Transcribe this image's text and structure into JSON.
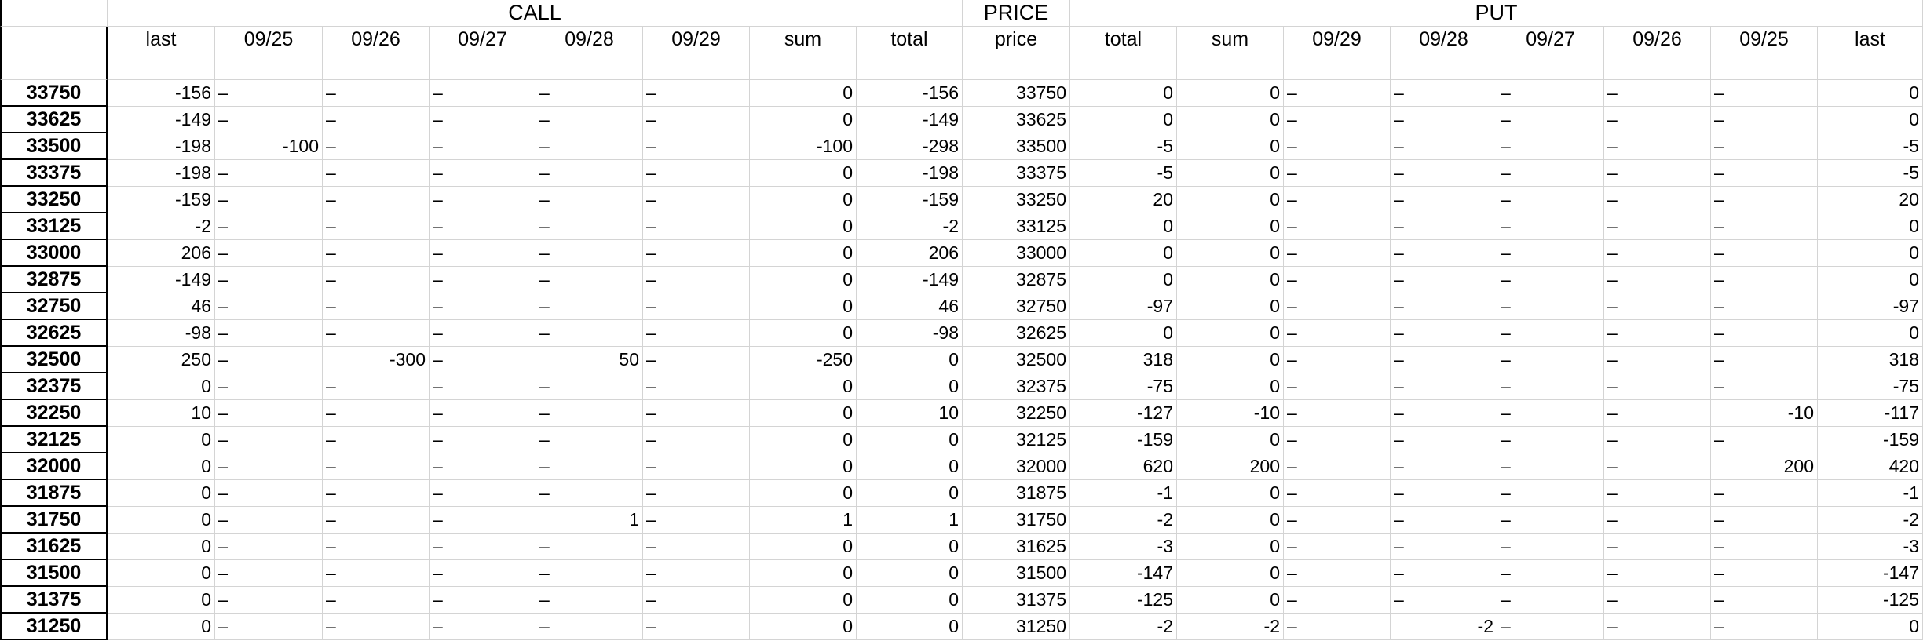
{
  "groups": [
    "CALL",
    "PRICE",
    "PUT"
  ],
  "columns": [
    "",
    "last",
    "09/25",
    "09/26",
    "09/27",
    "09/28",
    "09/29",
    "sum",
    "total",
    "price",
    "total",
    "sum",
    "09/29",
    "09/28",
    "09/27",
    "09/26",
    "09/25",
    "last"
  ],
  "rows": [
    [
      "33750",
      "-156",
      "–",
      "–",
      "–",
      "–",
      "–",
      "0",
      "-156",
      "33750",
      "0",
      "0",
      "–",
      "–",
      "–",
      "–",
      "–",
      "0"
    ],
    [
      "33625",
      "-149",
      "–",
      "–",
      "–",
      "–",
      "–",
      "0",
      "-149",
      "33625",
      "0",
      "0",
      "–",
      "–",
      "–",
      "–",
      "–",
      "0"
    ],
    [
      "33500",
      "-198",
      "-100",
      "–",
      "–",
      "–",
      "–",
      "-100",
      "-298",
      "33500",
      "-5",
      "0",
      "–",
      "–",
      "–",
      "–",
      "–",
      "-5"
    ],
    [
      "33375",
      "-198",
      "–",
      "–",
      "–",
      "–",
      "–",
      "0",
      "-198",
      "33375",
      "-5",
      "0",
      "–",
      "–",
      "–",
      "–",
      "–",
      "-5"
    ],
    [
      "33250",
      "-159",
      "–",
      "–",
      "–",
      "–",
      "–",
      "0",
      "-159",
      "33250",
      "20",
      "0",
      "–",
      "–",
      "–",
      "–",
      "–",
      "20"
    ],
    [
      "33125",
      "-2",
      "–",
      "–",
      "–",
      "–",
      "–",
      "0",
      "-2",
      "33125",
      "0",
      "0",
      "–",
      "–",
      "–",
      "–",
      "–",
      "0"
    ],
    [
      "33000",
      "206",
      "–",
      "–",
      "–",
      "–",
      "–",
      "0",
      "206",
      "33000",
      "0",
      "0",
      "–",
      "–",
      "–",
      "–",
      "–",
      "0"
    ],
    [
      "32875",
      "-149",
      "–",
      "–",
      "–",
      "–",
      "–",
      "0",
      "-149",
      "32875",
      "0",
      "0",
      "–",
      "–",
      "–",
      "–",
      "–",
      "0"
    ],
    [
      "32750",
      "46",
      "–",
      "–",
      "–",
      "–",
      "–",
      "0",
      "46",
      "32750",
      "-97",
      "0",
      "–",
      "–",
      "–",
      "–",
      "–",
      "-97"
    ],
    [
      "32625",
      "-98",
      "–",
      "–",
      "–",
      "–",
      "–",
      "0",
      "-98",
      "32625",
      "0",
      "0",
      "–",
      "–",
      "–",
      "–",
      "–",
      "0"
    ],
    [
      "32500",
      "250",
      "–",
      "-300",
      "–",
      "50",
      "–",
      "-250",
      "0",
      "32500",
      "318",
      "0",
      "–",
      "–",
      "–",
      "–",
      "–",
      "318"
    ],
    [
      "32375",
      "0",
      "–",
      "–",
      "–",
      "–",
      "–",
      "0",
      "0",
      "32375",
      "-75",
      "0",
      "–",
      "–",
      "–",
      "–",
      "–",
      "-75"
    ],
    [
      "32250",
      "10",
      "–",
      "–",
      "–",
      "–",
      "–",
      "0",
      "10",
      "32250",
      "-127",
      "-10",
      "–",
      "–",
      "–",
      "–",
      "-10",
      "-117"
    ],
    [
      "32125",
      "0",
      "–",
      "–",
      "–",
      "–",
      "–",
      "0",
      "0",
      "32125",
      "-159",
      "0",
      "–",
      "–",
      "–",
      "–",
      "–",
      "-159"
    ],
    [
      "32000",
      "0",
      "–",
      "–",
      "–",
      "–",
      "–",
      "0",
      "0",
      "32000",
      "620",
      "200",
      "–",
      "–",
      "–",
      "–",
      "200",
      "420"
    ],
    [
      "31875",
      "0",
      "–",
      "–",
      "–",
      "–",
      "–",
      "0",
      "0",
      "31875",
      "-1",
      "0",
      "–",
      "–",
      "–",
      "–",
      "–",
      "-1"
    ],
    [
      "31750",
      "0",
      "–",
      "–",
      "–",
      "1",
      "–",
      "1",
      "1",
      "31750",
      "-2",
      "0",
      "–",
      "–",
      "–",
      "–",
      "–",
      "-2"
    ],
    [
      "31625",
      "0",
      "–",
      "–",
      "–",
      "–",
      "–",
      "0",
      "0",
      "31625",
      "-3",
      "0",
      "–",
      "–",
      "–",
      "–",
      "–",
      "-3"
    ],
    [
      "31500",
      "0",
      "–",
      "–",
      "–",
      "–",
      "–",
      "0",
      "0",
      "31500",
      "-147",
      "0",
      "–",
      "–",
      "–",
      "–",
      "–",
      "-147"
    ],
    [
      "31375",
      "0",
      "–",
      "–",
      "–",
      "–",
      "–",
      "0",
      "0",
      "31375",
      "-125",
      "0",
      "–",
      "–",
      "–",
      "–",
      "–",
      "-125"
    ],
    [
      "31250",
      "0",
      "–",
      "–",
      "–",
      "–",
      "–",
      "0",
      "0",
      "31250",
      "-2",
      "-2",
      "–",
      "-2",
      "–",
      "–",
      "–",
      "0"
    ]
  ]
}
